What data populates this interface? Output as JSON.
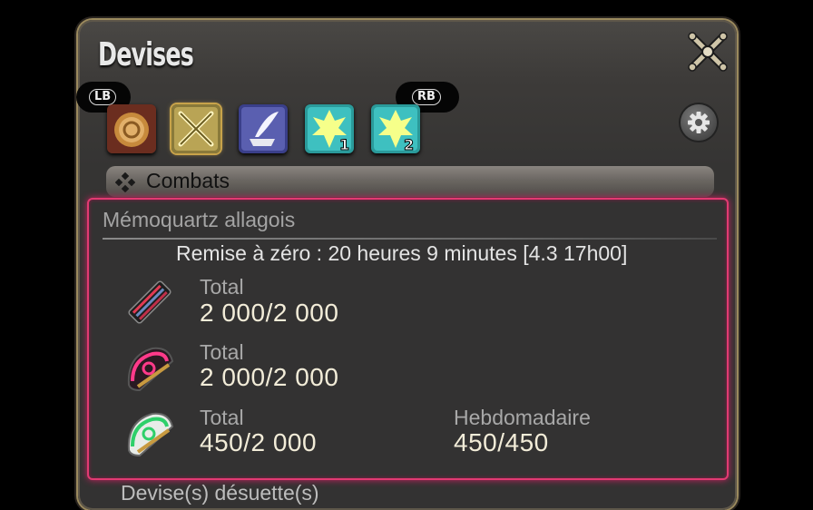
{
  "window": {
    "title": "Devises"
  },
  "controls": {
    "lb_label": "LB",
    "rb_label": "RB",
    "close_icon": "crossed-swords-close-icon",
    "settings_icon": "gear-icon"
  },
  "tabs": [
    {
      "icon": "gil-coin-icon",
      "badge": "",
      "selected": false
    },
    {
      "icon": "crossed-swords-icon",
      "badge": "",
      "selected": true
    },
    {
      "icon": "anvil-quill-icon",
      "badge": "",
      "selected": false
    },
    {
      "icon": "scrip-crystal-icon",
      "badge": "1",
      "selected": false
    },
    {
      "icon": "scrip-crystal-icon",
      "badge": "2",
      "selected": false
    }
  ],
  "section": {
    "label": "Combats"
  },
  "group": {
    "title": "Mémoquartz allagois",
    "reset": "Remise à zéro : 20 heures 9 minutes [4.3 17h00]",
    "rows": [
      {
        "icon": "red-tomestone-icon",
        "total_label": "Total",
        "total_value": "2 000/2 000"
      },
      {
        "icon": "pink-tomestone-icon",
        "total_label": "Total",
        "total_value": "2 000/2 000"
      },
      {
        "icon": "green-tomestone-icon",
        "total_label": "Total",
        "total_value": "450/2 000",
        "weekly_label": "Hebdomadaire",
        "weekly_value": "450/450"
      }
    ]
  },
  "next_section": {
    "label": "Devise(s) désuette(s)"
  },
  "colors": {
    "focus_border": "#e23a72",
    "value_text": "#f2ecd8",
    "selected_tab": "#c8a34a"
  }
}
